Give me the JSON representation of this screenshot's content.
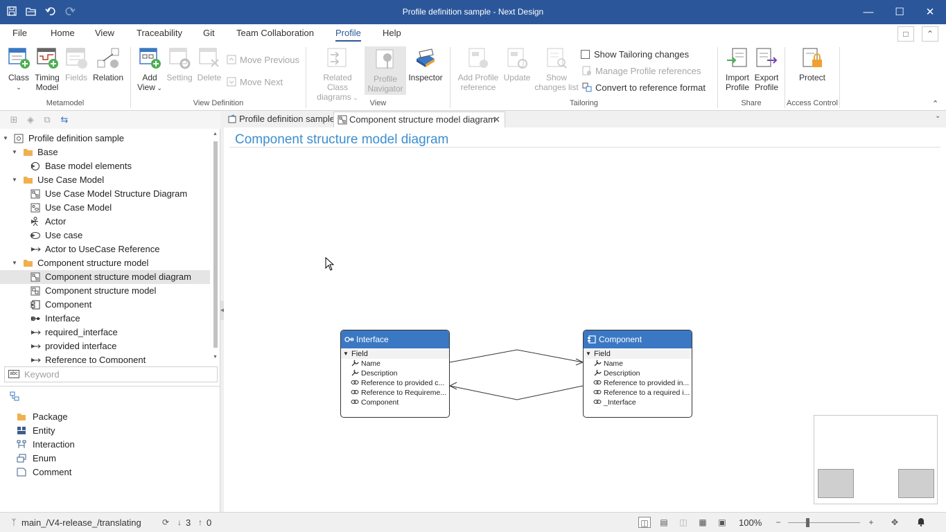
{
  "window": {
    "title": "Profile definition sample - Next Design"
  },
  "menu": {
    "items": [
      "File",
      "Home",
      "View",
      "Traceability",
      "Git",
      "Team Collaboration",
      "Profile",
      "Help"
    ],
    "active": "Profile"
  },
  "ribbon": {
    "metamodel": {
      "label": "Metamodel",
      "class": "Class",
      "timing_model_1": "Timing",
      "timing_model_2": "Model",
      "fields": "Fields",
      "relation": "Relation"
    },
    "view_definition": {
      "label": "View Definition",
      "add_view_1": "Add",
      "add_view_2": "View",
      "setting": "Setting",
      "delete": "Delete",
      "move_previous": "Move Previous",
      "move_next": "Move Next"
    },
    "view": {
      "label": "View",
      "related_class_diagrams_1": "Related Class",
      "related_class_diagrams_2": "diagrams",
      "profile_navigator_1": "Profile",
      "profile_navigator_2": "Navigator",
      "inspector": "Inspector"
    },
    "tailoring": {
      "label": "Tailoring",
      "add_profile_reference_1": "Add Profile",
      "add_profile_reference_2": "reference",
      "update": "Update",
      "show_changes_list_1": "Show",
      "show_changes_list_2": "changes list",
      "show_tailoring_changes": "Show Tailoring changes",
      "manage_profile_references": "Manage Profile references",
      "convert_to_reference_format": "Convert to reference format"
    },
    "share": {
      "label": "Share",
      "import_profile_1": "Import",
      "import_profile_2": "Profile",
      "export_profile_1": "Export",
      "export_profile_2": "Profile"
    },
    "access_control": {
      "label": "Access Control",
      "protect": "Protect"
    }
  },
  "tree": {
    "items": [
      {
        "label": "Profile definition sample",
        "icon": "profile-icon"
      },
      {
        "label": "Base",
        "icon": "folder-icon"
      },
      {
        "label": "Base model elements",
        "icon": "circle-icon"
      },
      {
        "label": "Use Case Model",
        "icon": "folder-icon"
      },
      {
        "label": "Use Case Model Structure Diagram",
        "icon": "diagram-icon"
      },
      {
        "label": "Use Case Model",
        "icon": "usecase-model-icon"
      },
      {
        "label": "Actor",
        "icon": "actor-icon"
      },
      {
        "label": "Use case",
        "icon": "ellipse-icon"
      },
      {
        "label": "Actor to UseCase Reference",
        "icon": "arrow-icon"
      },
      {
        "label": "Component structure model",
        "icon": "folder-icon"
      },
      {
        "label": "Component structure model diagram",
        "icon": "diagram-icon"
      },
      {
        "label": "Component structure model",
        "icon": "model-icon"
      },
      {
        "label": "Component",
        "icon": "component-icon"
      },
      {
        "label": "Interface",
        "icon": "interface-icon"
      },
      {
        "label": "required_interface",
        "icon": "arrow-icon"
      },
      {
        "label": "provided interface",
        "icon": "arrow-icon"
      },
      {
        "label": "Reference to Component",
        "icon": "arrow-icon"
      }
    ],
    "selected": "Component structure model diagram"
  },
  "search": {
    "placeholder": "Keyword",
    "value": ""
  },
  "palette": {
    "items": [
      "Package",
      "Entity",
      "Interaction",
      "Enum",
      "Comment"
    ]
  },
  "tabs": [
    {
      "label": "Profile definition sample"
    },
    {
      "label": "Component structure model diagram"
    }
  ],
  "diagram": {
    "title": "Component structure model diagram",
    "nodes": [
      {
        "name": "Interface",
        "group": "Field",
        "fields": [
          "Name",
          "Description",
          "Reference to provided c...",
          "Reference to Requireme...",
          "Component"
        ]
      },
      {
        "name": "Component",
        "group": "Field",
        "fields": [
          "Name",
          "Description",
          "Reference to provided in...",
          "Reference to a required i...",
          "_Interface"
        ]
      }
    ]
  },
  "statusbar": {
    "branch": "main_/V4-release_/translating",
    "incoming": "3",
    "outgoing": "0",
    "zoom": "100%"
  },
  "colors": {
    "titlebar": "#2b579a",
    "accent": "#2b579a",
    "node_header": "#3b78c4",
    "diagram_title": "#3b8ed0"
  }
}
